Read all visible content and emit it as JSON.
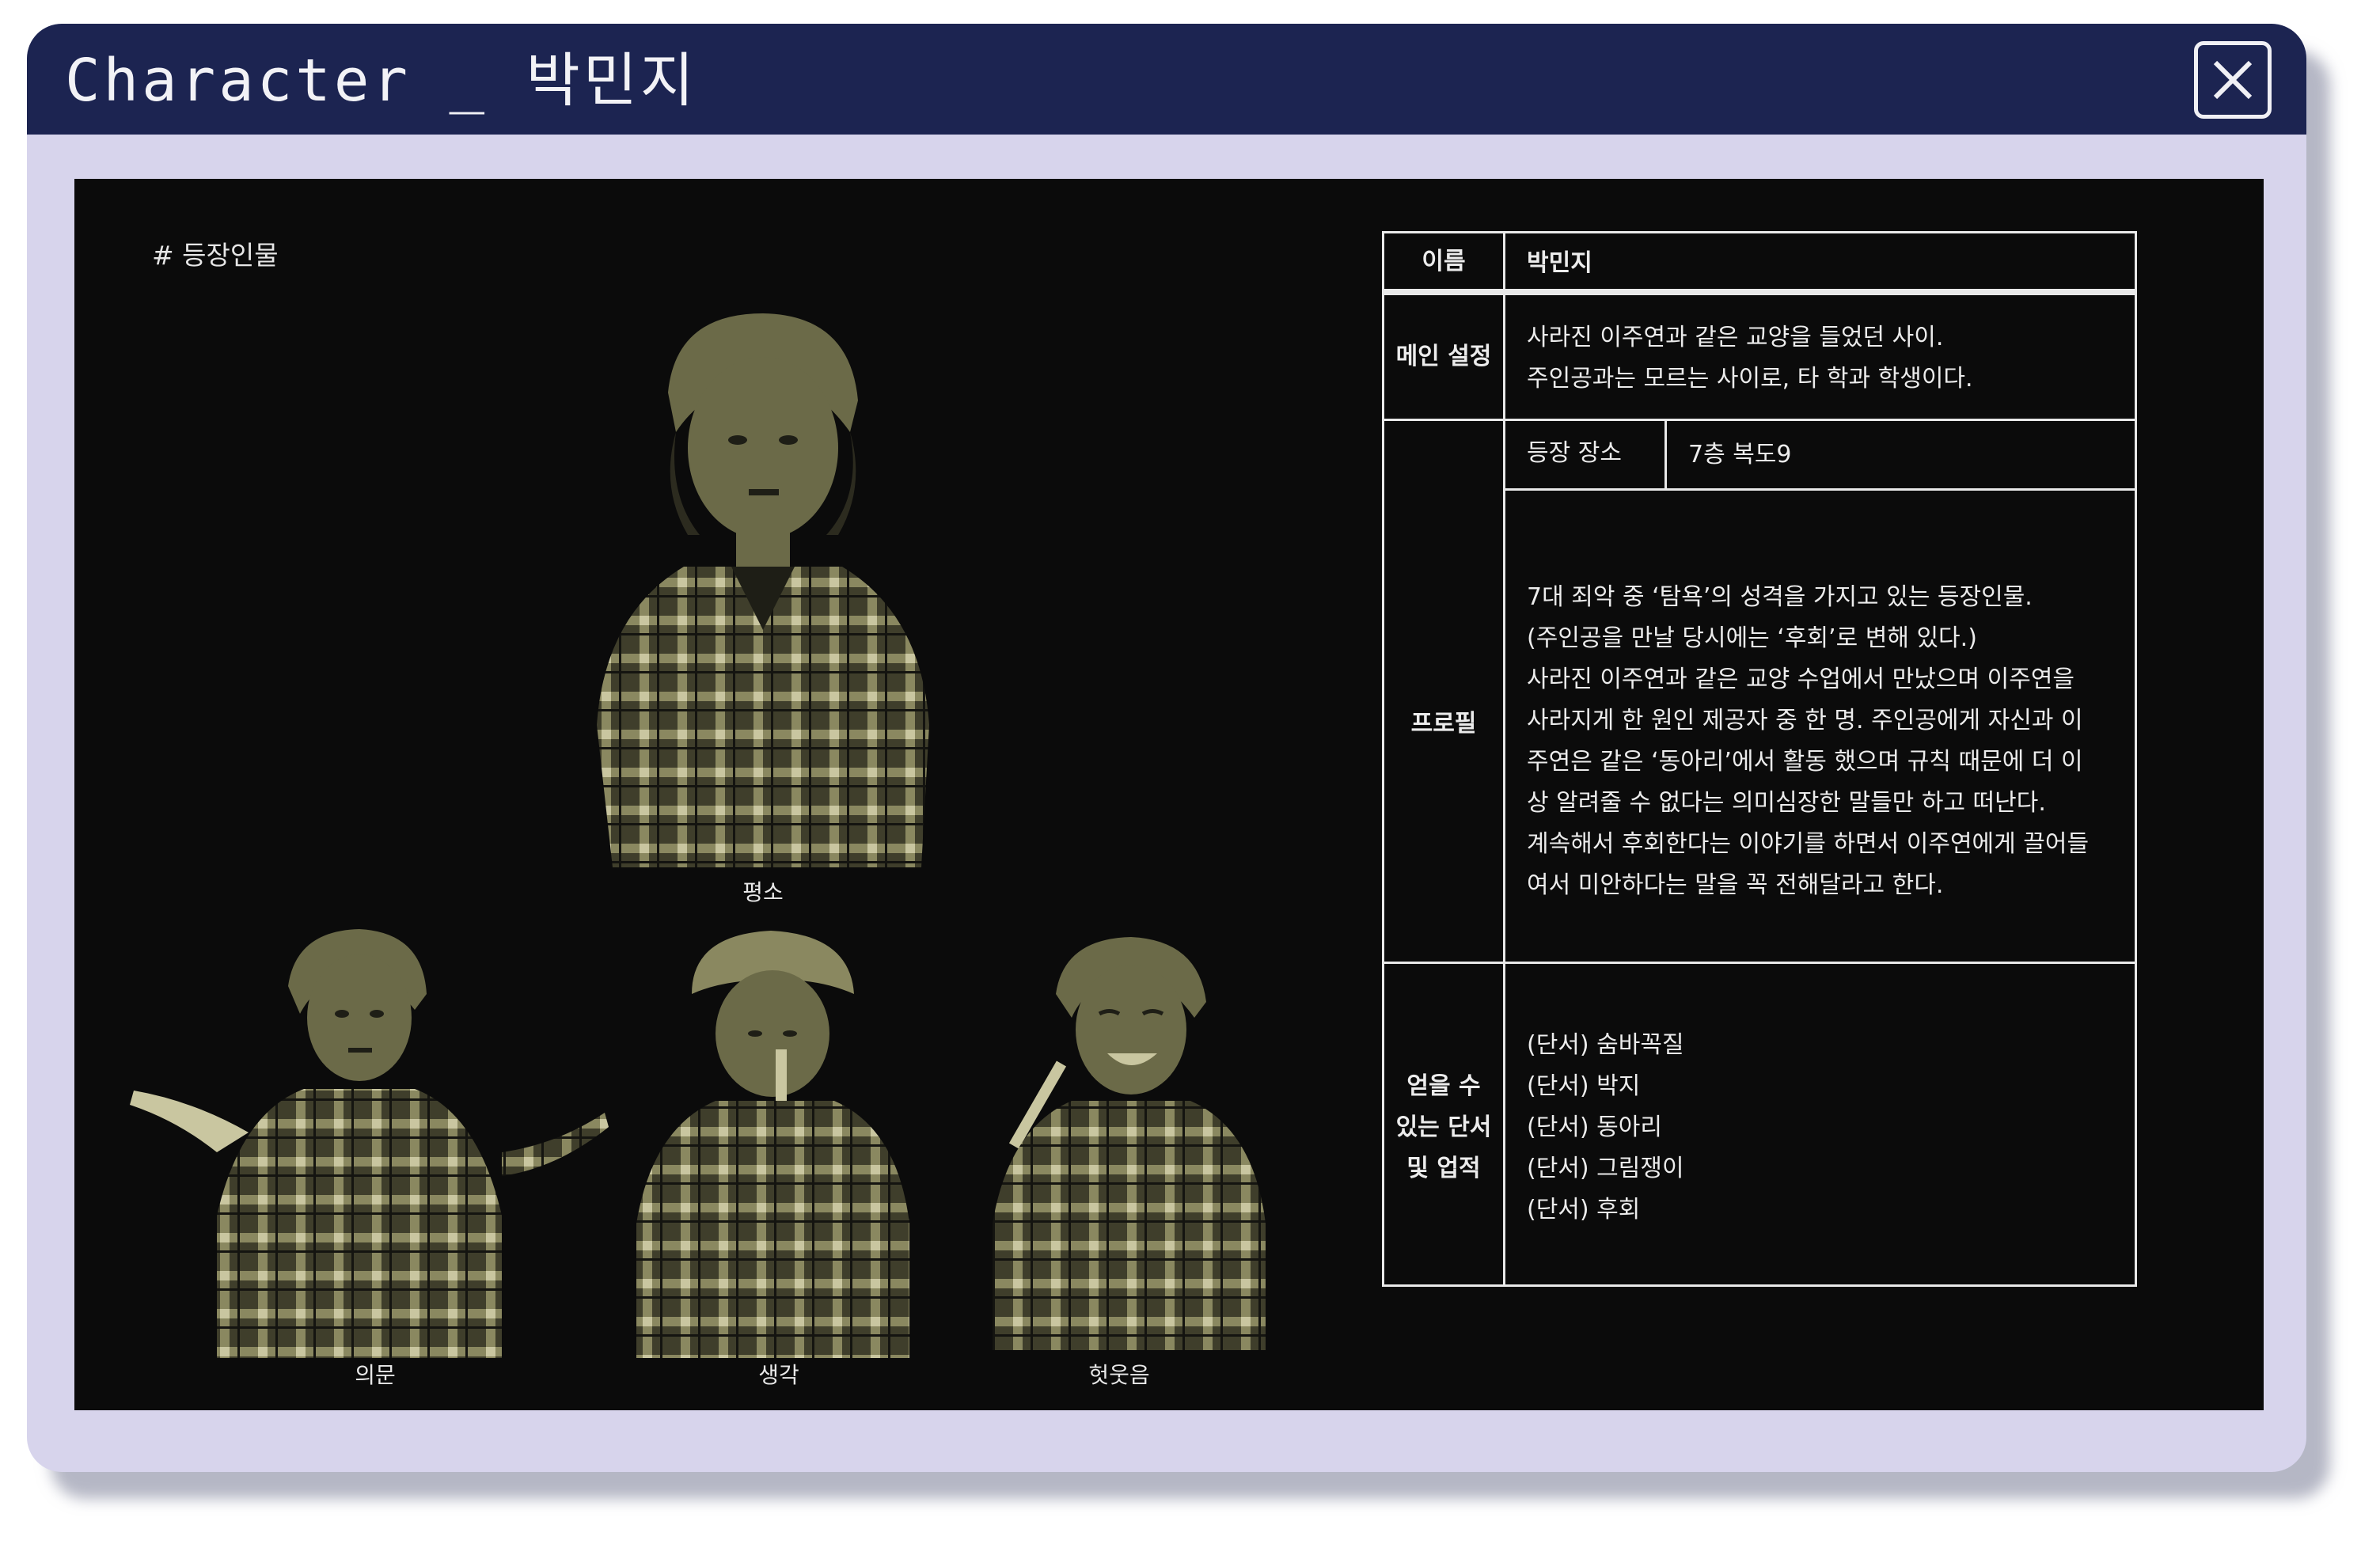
{
  "window": {
    "title": "Character _ 박민지",
    "close_icon": "close-icon"
  },
  "section": {
    "label": "# 등장인물"
  },
  "portraits": [
    {
      "caption": "평소"
    },
    {
      "caption": "의문"
    },
    {
      "caption": "생각"
    },
    {
      "caption": "헛웃음"
    }
  ],
  "profile": {
    "name_header": "이름",
    "name_value": "박민지",
    "setting_header": "메인 설정",
    "setting_lines": [
      "사라진 이주연과 같은 교양을 들었던 사이.",
      "주인공과는 모르는 사이로, 타 학과 학생이다."
    ],
    "profile_header": "프로필",
    "location_label": "등장 장소",
    "location_value": "7층 복도9",
    "profile_lines": [
      "7대 죄악 중 ‘탐욕’의 성격을 가지고 있는 등장인물.",
      "(주인공을 만날 당시에는 ‘후회’로 변해 있다.)",
      "사라진 이주연과 같은 교양 수업에서 만났으며 이주연을",
      "사라지게 한 원인 제공자 중 한 명. 주인공에게 자신과 이",
      "주연은 같은 ‘동아리’에서 활동 했으며 규칙 때문에 더 이",
      "상 알려줄 수 없다는 의미심장한 말들만 하고 떠난다.",
      "계속해서 후회한다는 이야기를 하면서 이주연에게 끌어들",
      "여서 미안하다는 말을 꼭 전해달라고 한다."
    ],
    "clues_header_lines": [
      "얻을 수",
      "있는 단서",
      "및 업적"
    ],
    "clues": [
      "(단서) 숨바꼭질",
      "(단서) 박지",
      "(단서) 동아리",
      "(단서) 그림쟁이",
      "(단서) 후회"
    ]
  },
  "colors": {
    "titlebar": "#1c2451",
    "frame": "#d7d4ec",
    "panel": "#0b0b0b",
    "figure_tone": "#6b6a48"
  }
}
